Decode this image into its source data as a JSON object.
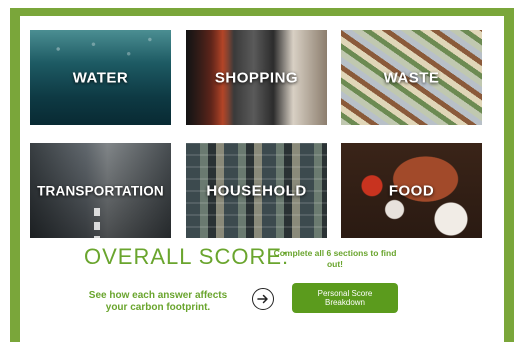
{
  "tiles": [
    {
      "label": "WATER",
      "icon": "water-photo"
    },
    {
      "label": "SHOPPING",
      "icon": "shopping-photo"
    },
    {
      "label": "WASTE",
      "icon": "waste-photo"
    },
    {
      "label": "TRANSPORTATION",
      "icon": "transportation-photo"
    },
    {
      "label": "HOUSEHOLD",
      "icon": "household-photo"
    },
    {
      "label": "FOOD",
      "icon": "food-photo"
    }
  ],
  "score": {
    "title": "OVERALL SCORE:",
    "hint": "Complete all 6 sections to find out!"
  },
  "footer": {
    "affect_text": "See how each answer affects your carbon footprint.",
    "arrow_icon": "arrow-right-circle-icon",
    "breakdown_label": "Personal Score Breakdown"
  },
  "colors": {
    "frame": "#7aa63a",
    "accent_green": "#6aa52e",
    "button_green": "#5b9b1d"
  }
}
